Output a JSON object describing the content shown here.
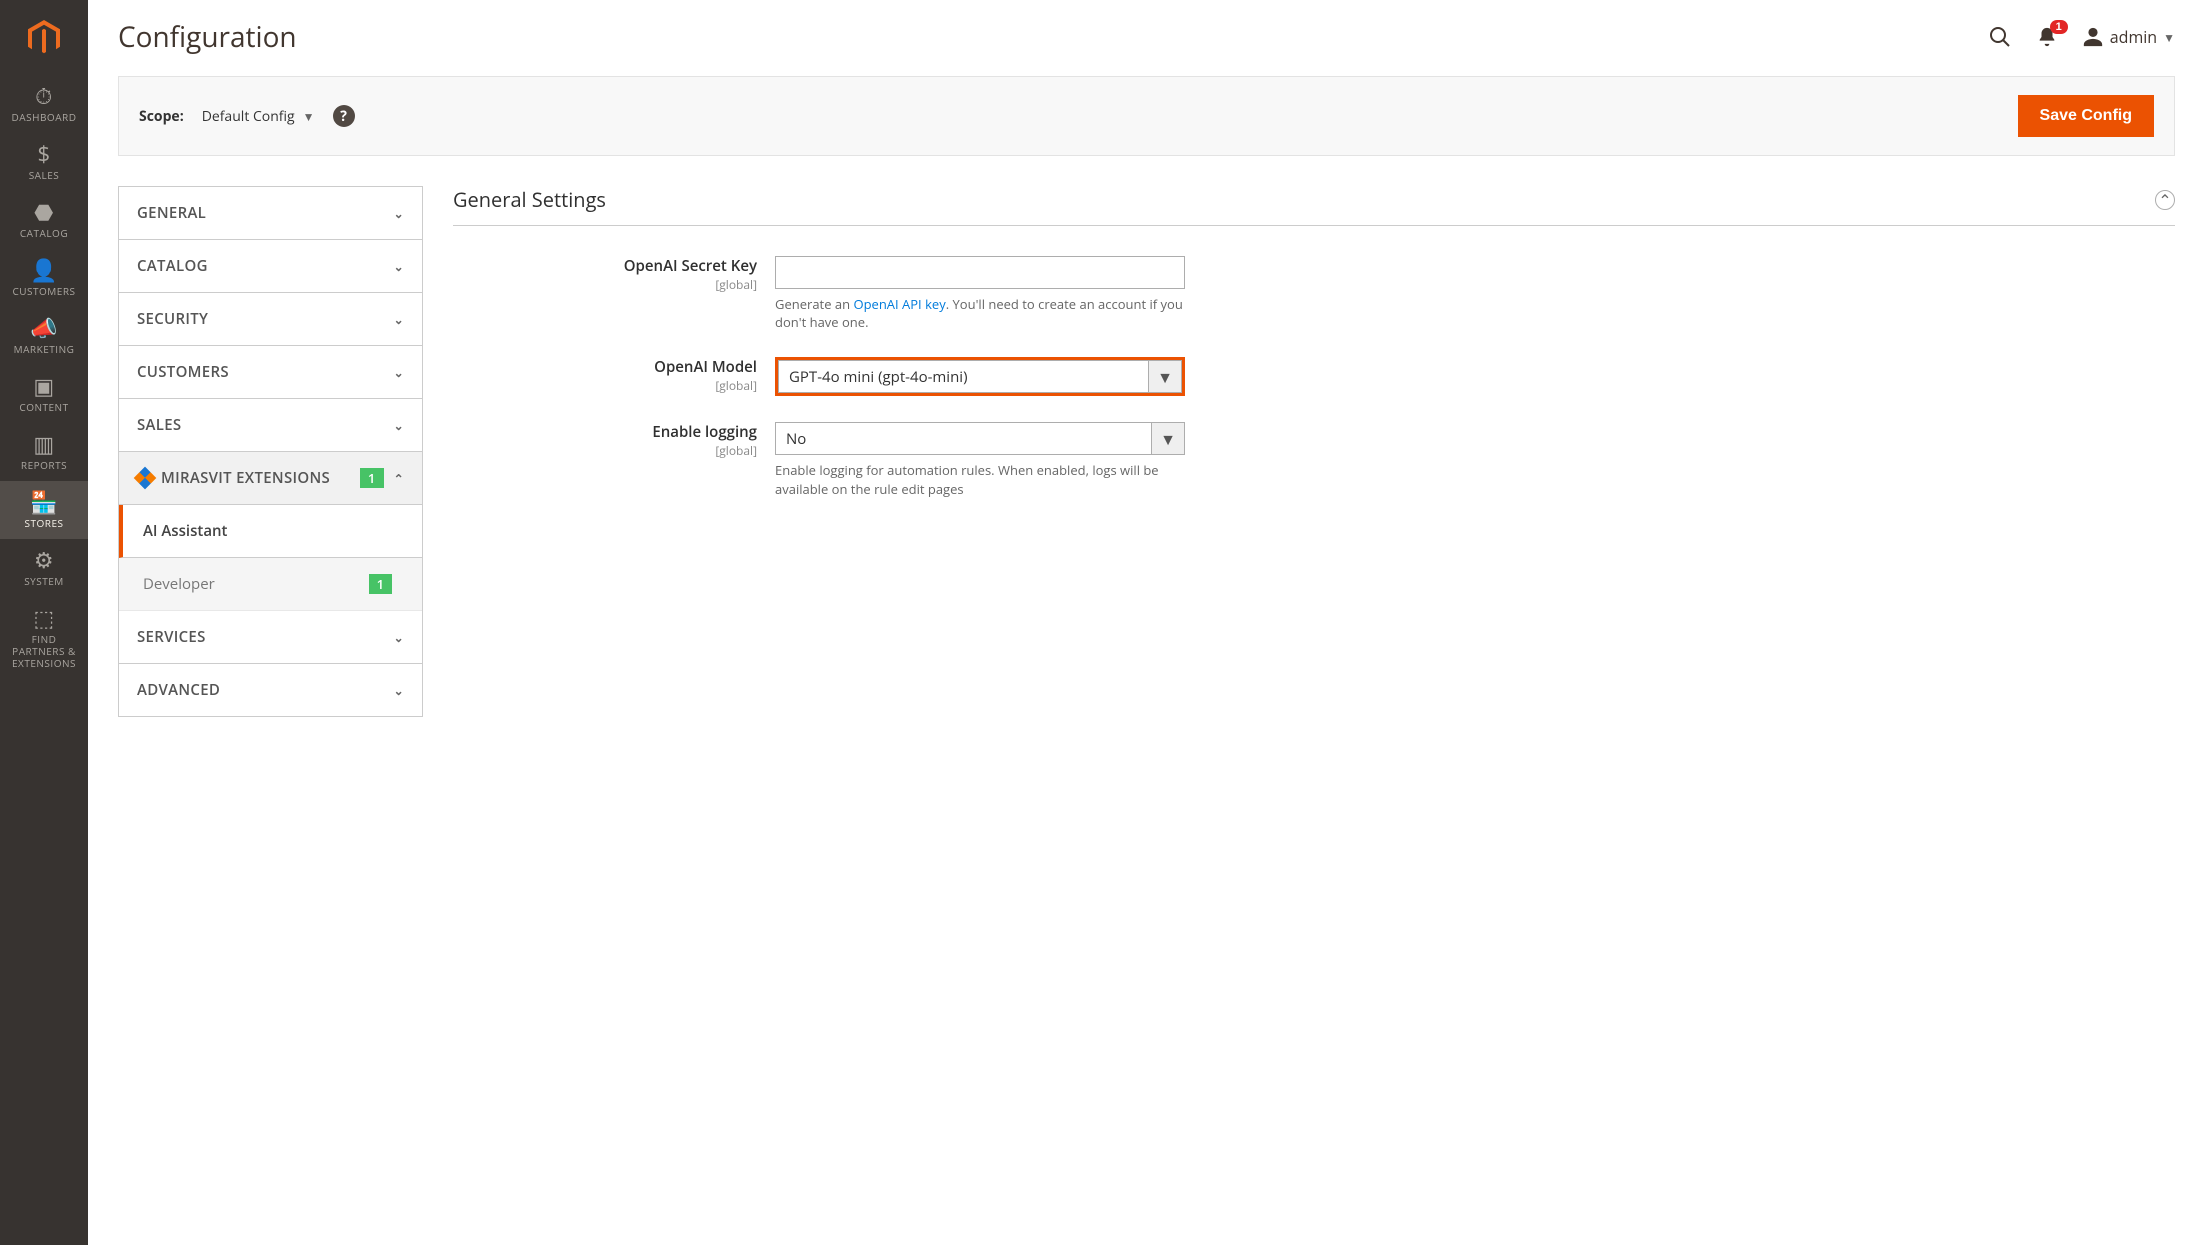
{
  "sidebar": {
    "items": [
      {
        "label": "DASHBOARD"
      },
      {
        "label": "SALES"
      },
      {
        "label": "CATALOG"
      },
      {
        "label": "CUSTOMERS"
      },
      {
        "label": "MARKETING"
      },
      {
        "label": "CONTENT"
      },
      {
        "label": "REPORTS"
      },
      {
        "label": "STORES"
      },
      {
        "label": "SYSTEM"
      },
      {
        "label": "FIND PARTNERS & EXTENSIONS"
      }
    ]
  },
  "header": {
    "page_title": "Configuration",
    "notification_count": "1",
    "username": "admin"
  },
  "scope": {
    "label": "Scope:",
    "value": "Default Config",
    "save_label": "Save Config"
  },
  "tabs": {
    "general": "GENERAL",
    "catalog": "CATALOG",
    "security": "SECURITY",
    "customers": "CUSTOMERS",
    "sales": "SALES",
    "mirasvit": "MIRASVIT EXTENSIONS",
    "mirasvit_badge": "1",
    "sub_ai": "AI Assistant",
    "sub_dev": "Developer",
    "sub_dev_badge": "1",
    "services": "SERVICES",
    "advanced": "ADVANCED"
  },
  "panel": {
    "section_title": "General Settings",
    "fields": {
      "secret": {
        "label": "OpenAI Secret Key",
        "scope": "[global]",
        "note_prefix": "Generate an ",
        "note_link": "OpenAI API key",
        "note_suffix": ". You'll need to create an account if you don't have one."
      },
      "model": {
        "label": "OpenAI Model",
        "scope": "[global]",
        "value": "GPT-4o mini (gpt-4o-mini)"
      },
      "logging": {
        "label": "Enable logging",
        "scope": "[global]",
        "value": "No",
        "note": "Enable logging for automation rules. When enabled, logs will be available on the rule edit pages"
      }
    }
  }
}
